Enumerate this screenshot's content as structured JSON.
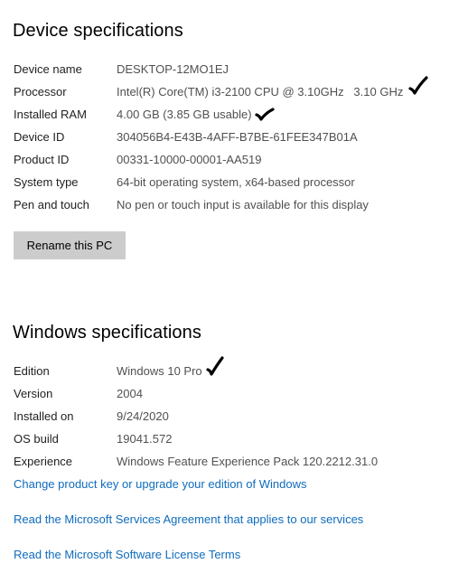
{
  "device": {
    "title": "Device specifications",
    "specs": [
      {
        "label": "Device name",
        "value": "DESKTOP-12MO1EJ"
      },
      {
        "label": "Processor",
        "value": "Intel(R) Core(TM) i3-2100 CPU @ 3.10GHz   3.10 GHz"
      },
      {
        "label": "Installed RAM",
        "value": "4.00 GB (3.85 GB usable)"
      },
      {
        "label": "Device ID",
        "value": "304056B4-E43B-4AFF-B7BE-61FEE347B01A"
      },
      {
        "label": "Product ID",
        "value": "00331-10000-00001-AA519"
      },
      {
        "label": "System type",
        "value": "64-bit operating system, x64-based processor"
      },
      {
        "label": "Pen and touch",
        "value": "No pen or touch input is available for this display"
      }
    ],
    "rename_button": "Rename this PC"
  },
  "windows": {
    "title": "Windows specifications",
    "specs": [
      {
        "label": "Edition",
        "value": "Windows 10 Pro"
      },
      {
        "label": "Version",
        "value": "2004"
      },
      {
        "label": "Installed on",
        "value": "9/24/2020"
      },
      {
        "label": "OS build",
        "value": "19041.572"
      },
      {
        "label": "Experience",
        "value": "Windows Feature Experience Pack 120.2212.31.0"
      }
    ]
  },
  "links": {
    "change_key": "Change product key or upgrade your edition of Windows",
    "services_agreement": "Read the Microsoft Services Agreement that applies to our services",
    "license_terms": "Read the Microsoft Software License Terms"
  },
  "colors": {
    "link": "#0f6cbd",
    "button_bg": "#cccccc",
    "value_text": "#505050"
  },
  "annotations": {
    "handwritten_marks": "checkmark-icon"
  }
}
